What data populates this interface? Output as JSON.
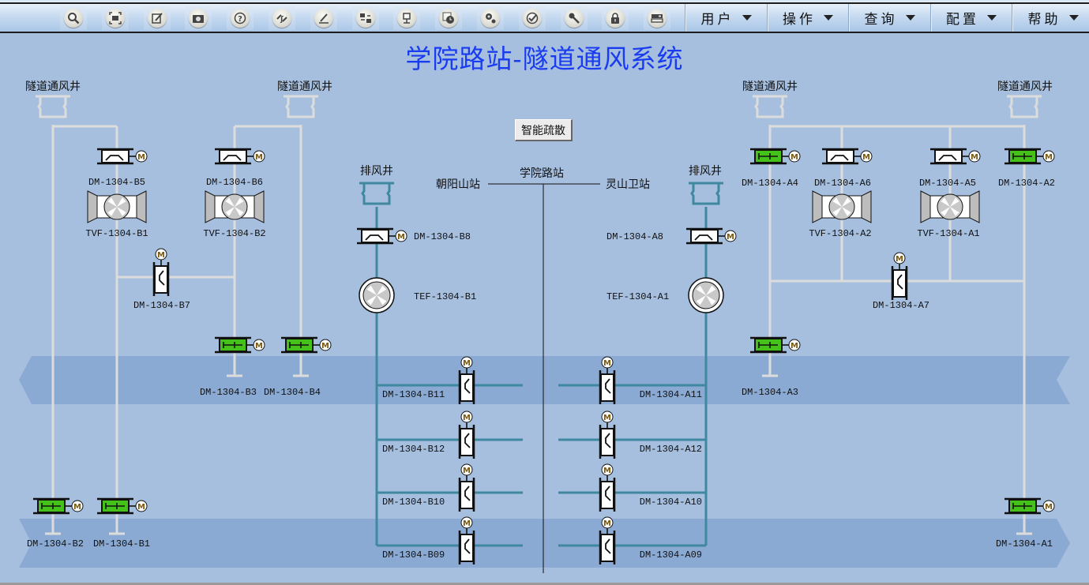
{
  "toolbar": {
    "tools": [
      {
        "name": "search-icon",
        "label": "Search"
      },
      {
        "name": "fullscreen-icon",
        "label": "Fullscreen"
      },
      {
        "name": "edit-icon",
        "label": "Edit"
      },
      {
        "name": "camera-icon",
        "label": "Snapshot"
      },
      {
        "name": "help-icon",
        "label": "Help"
      },
      {
        "name": "switch-icon",
        "label": "Switch"
      },
      {
        "name": "sign-icon",
        "label": "Sign"
      },
      {
        "name": "flow-icon",
        "label": "Flow"
      },
      {
        "name": "network-icon",
        "label": "Network"
      },
      {
        "name": "history-icon",
        "label": "History"
      },
      {
        "name": "settings-icon",
        "label": "Settings"
      },
      {
        "name": "check-icon",
        "label": "Check"
      },
      {
        "name": "key-icon",
        "label": "Key"
      },
      {
        "name": "lock-icon",
        "label": "Lock"
      },
      {
        "name": "server-icon",
        "label": "Server"
      }
    ],
    "menus": [
      "用户",
      "操作",
      "查询",
      "配置",
      "帮助"
    ]
  },
  "title": "学院路站-隧道通风系统",
  "smart_evacuation_button": "智能疏散",
  "stations": {
    "left": "朝阳山站",
    "center": "学院路站",
    "right": "灵山卫站"
  },
  "shafts": {
    "tunnel_vent": "隧道通风井",
    "exhaust": "排风井"
  },
  "devices": {
    "fans": {
      "TVF_B1": "TVF-1304-B1",
      "TVF_B2": "TVF-1304-B2",
      "TVF_A1": "TVF-1304-A1",
      "TVF_A2": "TVF-1304-A2",
      "TEF_B1": "TEF-1304-B1",
      "TEF_A1": "TEF-1304-A1"
    },
    "dampers": {
      "B1": {
        "label": "DM-1304-B1",
        "state": "open"
      },
      "B2": {
        "label": "DM-1304-B2",
        "state": "open"
      },
      "B3": {
        "label": "DM-1304-B3",
        "state": "open"
      },
      "B4": {
        "label": "DM-1304-B4",
        "state": "open"
      },
      "B5": {
        "label": "DM-1304-B5",
        "state": "closed"
      },
      "B6": {
        "label": "DM-1304-B6",
        "state": "closed"
      },
      "B7": {
        "label": "DM-1304-B7",
        "state": "closed"
      },
      "B8": {
        "label": "DM-1304-B8",
        "state": "closed"
      },
      "B09": {
        "label": "DM-1304-B09",
        "state": "closed"
      },
      "B10": {
        "label": "DM-1304-B10",
        "state": "closed"
      },
      "B11": {
        "label": "DM-1304-B11",
        "state": "closed"
      },
      "B12": {
        "label": "DM-1304-B12",
        "state": "closed"
      },
      "A1": {
        "label": "DM-1304-A1",
        "state": "open"
      },
      "A2": {
        "label": "DM-1304-A2",
        "state": "open"
      },
      "A3": {
        "label": "DM-1304-A3",
        "state": "open"
      },
      "A4": {
        "label": "DM-1304-A4",
        "state": "open"
      },
      "A5": {
        "label": "DM-1304-A5",
        "state": "closed"
      },
      "A6": {
        "label": "DM-1304-A6",
        "state": "closed"
      },
      "A7": {
        "label": "DM-1304-A7",
        "state": "closed"
      },
      "A8": {
        "label": "DM-1304-A8",
        "state": "closed"
      },
      "A09": {
        "label": "DM-1304-A09",
        "state": "closed"
      },
      "A10": {
        "label": "DM-1304-A10",
        "state": "closed"
      },
      "A11": {
        "label": "DM-1304-A11",
        "state": "closed"
      },
      "A12": {
        "label": "DM-1304-A12",
        "state": "closed"
      }
    },
    "motor_glyph": "M"
  },
  "colors": {
    "background": "#a6bfdf",
    "track_band": "#8aaad3",
    "duct_light": "#dcdcdc",
    "duct_exhaust": "#3f88a0",
    "damper_open": "#44c21a",
    "title": "#1a3cf0"
  }
}
